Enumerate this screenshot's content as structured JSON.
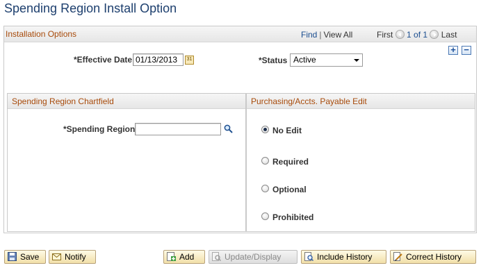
{
  "page": {
    "title": "Spending Region Install Option"
  },
  "installation": {
    "title": "Installation Options",
    "find": "Find",
    "separator": "|",
    "view_all": "View All",
    "first": "First",
    "counter": "1 of 1",
    "last": "Last",
    "add_row": "+",
    "delete_row": "−",
    "effective_date": {
      "label": "*Effective Date",
      "value": "01/13/2013",
      "calendar_text": "31"
    },
    "status": {
      "label": "*Status",
      "value": "Active"
    }
  },
  "chartfield": {
    "title": "Spending Region Chartfield",
    "spending_region": {
      "label": "*Spending Region",
      "value": ""
    }
  },
  "edit": {
    "title": "Purchasing/Accts. Payable Edit",
    "options": [
      {
        "label": "No Edit",
        "checked": true
      },
      {
        "label": "Required",
        "checked": false
      },
      {
        "label": "Optional",
        "checked": false
      },
      {
        "label": "Prohibited",
        "checked": false
      }
    ]
  },
  "toolbar": {
    "save": "Save",
    "notify": "Notify",
    "add": "Add",
    "update_display": "Update/Display",
    "include_history": "Include History",
    "correct_history": "Correct History"
  }
}
